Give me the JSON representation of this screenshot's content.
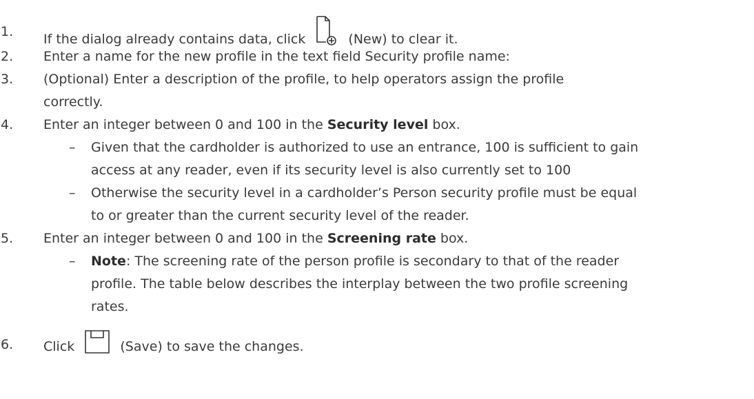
{
  "steps": [
    {
      "num": "1.",
      "before": "If the dialog already contains data, click",
      "icon": "new-document-icon",
      "after": "(New) to clear it."
    },
    {
      "num": "2.",
      "text": "Enter a name for the new profile in the text field Security profile name:"
    },
    {
      "num": "3.",
      "line1": "(Optional) Enter a description of the profile, to help operators assign the profile",
      "line2": "correctly."
    },
    {
      "num": "4.",
      "before": "Enter an integer between 0 and 100 in the",
      "bold": "Security level",
      "after": "box.",
      "bullets": [
        {
          "dash": "–",
          "line1": "Given that the cardholder is authorized to use an entrance, 100 is sufficient to gain",
          "line2": "access at any reader, even if its security level is also currently set to 100"
        },
        {
          "dash": "–",
          "line1": "Otherwise the security level in a cardholder’s Person security profile must be equal",
          "line2": "to or greater than the current security level of the reader."
        }
      ]
    },
    {
      "num": "5.",
      "before": "Enter an integer between 0 and 100 in the",
      "bold": "Screening rate",
      "after": "box.",
      "bullets": [
        {
          "dash": "–",
          "bold": "Note",
          "line1": ": The screening rate of the person profile is secondary to that of the reader",
          "line2": "profile. The table below describes the interplay between the two profile screening",
          "line3": "rates."
        }
      ]
    },
    {
      "num": "6.",
      "before": "Click",
      "icon": "save-icon",
      "after": "(Save) to save the changes."
    }
  ]
}
